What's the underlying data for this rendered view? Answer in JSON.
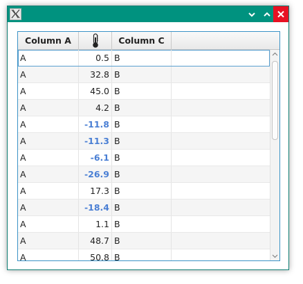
{
  "window": {
    "app_icon": "x-window-icon",
    "controls": [
      "minimize-icon",
      "maximize-icon",
      "close-icon"
    ],
    "title_bar_color": "#00927f",
    "close_color": "#e81123"
  },
  "table": {
    "columns": [
      {
        "label": "Column A"
      },
      {
        "label": "",
        "icon": "thermometer-icon"
      },
      {
        "label": "Column C"
      }
    ],
    "negative_color": "#4a7fd4",
    "selected_row": 0,
    "rows": [
      {
        "a": "A",
        "b": "0.5",
        "c": "B"
      },
      {
        "a": "A",
        "b": "32.8",
        "c": "B"
      },
      {
        "a": "A",
        "b": "45.0",
        "c": "B"
      },
      {
        "a": "A",
        "b": "4.2",
        "c": "B"
      },
      {
        "a": "A",
        "b": "-11.8",
        "c": "B"
      },
      {
        "a": "A",
        "b": "-11.3",
        "c": "B"
      },
      {
        "a": "A",
        "b": "-6.1",
        "c": "B"
      },
      {
        "a": "A",
        "b": "-26.9",
        "c": "B"
      },
      {
        "a": "A",
        "b": "17.3",
        "c": "B"
      },
      {
        "a": "A",
        "b": "-18.4",
        "c": "B"
      },
      {
        "a": "A",
        "b": "1.1",
        "c": "B"
      },
      {
        "a": "A",
        "b": "48.7",
        "c": "B"
      },
      {
        "a": "A",
        "b": "50.8",
        "c": "B"
      }
    ]
  }
}
